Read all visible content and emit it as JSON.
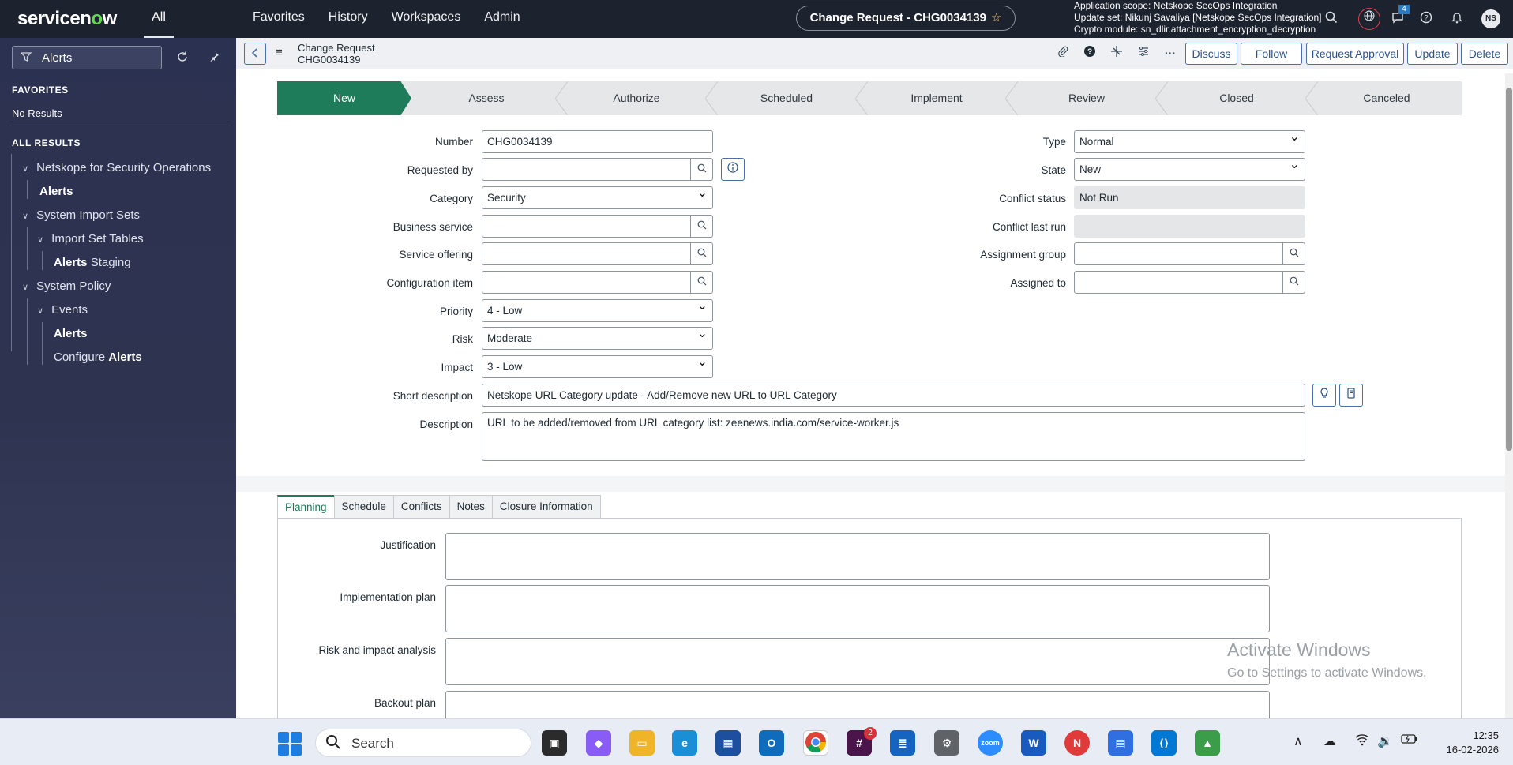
{
  "topbar": {
    "logo_prefix": "servicen",
    "logo_o": "o",
    "logo_suffix": "w",
    "all_tab": "All",
    "nav": [
      "Favorites",
      "History",
      "Workspaces",
      "Admin"
    ],
    "record_pill": "Change Request - CHG0034139",
    "scope_lines": [
      "Application scope: Netskope SecOps Integration",
      "Update set: Nikunj Savaliya [Netskope SecOps Integration]",
      "Crypto module: sn_dlir.attachment_encryption_decryption"
    ],
    "notification_count": "4",
    "avatar": "NS"
  },
  "sidebar": {
    "filter_value": "Alerts",
    "favorites_heading": "FAVORITES",
    "no_results": "No Results",
    "all_results_heading": "ALL RESULTS",
    "items": [
      {
        "label": "Netskope for Security Operations"
      },
      {
        "label": "Alerts"
      },
      {
        "label": "System Import Sets"
      },
      {
        "label": "Import Set Tables"
      },
      {
        "label": "Alerts",
        "suffix": " Staging"
      },
      {
        "label": "System Policy"
      },
      {
        "label": "Events"
      },
      {
        "label": "Alerts"
      },
      {
        "label": "Configure ",
        "suffix": "Alerts"
      }
    ]
  },
  "header": {
    "title": "Change Request",
    "subtitle": "CHG0034139",
    "buttons": [
      "Discuss",
      "Follow",
      "Request Approval",
      "Update",
      "Delete"
    ]
  },
  "flow": [
    "New",
    "Assess",
    "Authorize",
    "Scheduled",
    "Implement",
    "Review",
    "Closed",
    "Canceled"
  ],
  "form": {
    "left": {
      "number": {
        "label": "Number",
        "value": "CHG0034139"
      },
      "requested_by": {
        "label": "Requested by",
        "value": ""
      },
      "category": {
        "label": "Category",
        "value": "Security"
      },
      "business_service": {
        "label": "Business service",
        "value": ""
      },
      "service_offering": {
        "label": "Service offering",
        "value": ""
      },
      "configuration_item": {
        "label": "Configuration item",
        "value": ""
      },
      "priority": {
        "label": "Priority",
        "value": "4 - Low"
      },
      "risk": {
        "label": "Risk",
        "value": "Moderate"
      },
      "impact": {
        "label": "Impact",
        "value": "3 - Low"
      }
    },
    "right": {
      "type": {
        "label": "Type",
        "value": "Normal"
      },
      "state": {
        "label": "State",
        "value": "New"
      },
      "conflict_status": {
        "label": "Conflict status",
        "value": "Not Run"
      },
      "conflict_last_run": {
        "label": "Conflict last run",
        "value": ""
      },
      "assignment_group": {
        "label": "Assignment group",
        "value": ""
      },
      "assigned_to": {
        "label": "Assigned to",
        "value": ""
      }
    },
    "short_description": {
      "label": "Short description",
      "value": "Netskope URL Category update - Add/Remove new URL to URL Category"
    },
    "description": {
      "label": "Description",
      "value": "URL to be added/removed from URL category list: zeenews.india.com/service-worker.js"
    }
  },
  "tabs": [
    "Planning",
    "Schedule",
    "Conflicts",
    "Notes",
    "Closure Information"
  ],
  "planning": [
    "Justification",
    "Implementation plan",
    "Risk and impact analysis",
    "Backout plan"
  ],
  "watermark": {
    "line1": "Activate Windows",
    "line2": "Go to Settings to activate Windows."
  },
  "taskbar": {
    "search": "Search",
    "time": "12:35",
    "date": "16-02-2026",
    "slack_badge": "2"
  },
  "colors": {
    "brand_green": "#1f7c5a",
    "topbar": "#1d222f",
    "link_blue": "#2d528a"
  }
}
